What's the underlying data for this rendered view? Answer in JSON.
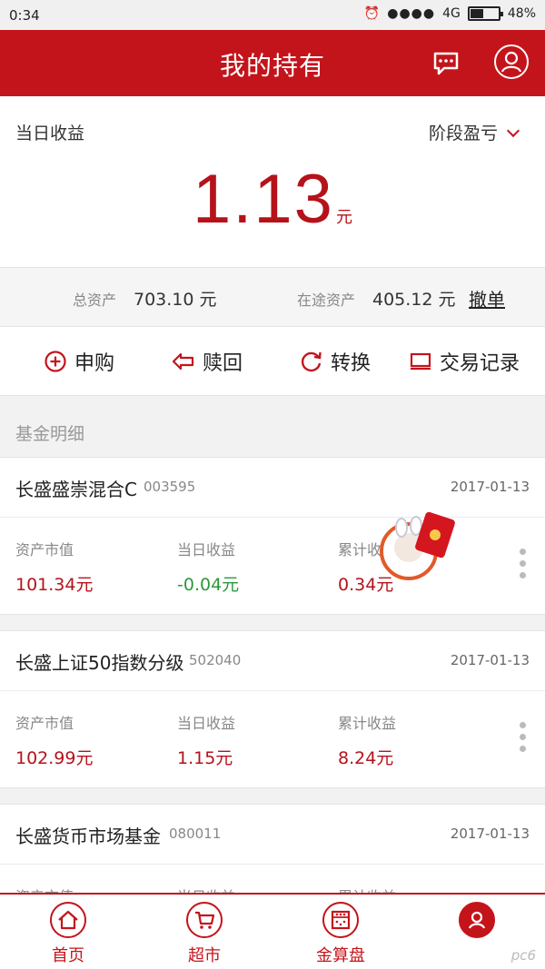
{
  "status_bar": {
    "time": "0:34",
    "network": "4G",
    "battery": "48%",
    "battery_level": 0.48
  },
  "header": {
    "title": "我的持有",
    "message_icon": "chat-icon",
    "user_icon": "user-icon"
  },
  "earnings": {
    "label": "当日收益",
    "period_label": "阶段盈亏",
    "value": "1.13",
    "unit": "元"
  },
  "assets": {
    "total_label": "总资产",
    "total_value": "703.10 元",
    "transit_label": "在途资产",
    "transit_value": "405.12 元",
    "cancel_label": "撤单"
  },
  "actions": [
    {
      "label": "申购",
      "icon": "plus-circle-icon"
    },
    {
      "label": "赎回",
      "icon": "arrow-left-icon"
    },
    {
      "label": "转换",
      "icon": "refresh-icon"
    },
    {
      "label": "交易记录",
      "icon": "monitor-icon"
    }
  ],
  "section_label": "基金明细",
  "funds": [
    {
      "name": "长盛盛崇混合C",
      "code": "003595",
      "date": "2017-01-13",
      "metrics": [
        {
          "label": "资产市值",
          "value": "101.34元"
        },
        {
          "label": "当日收益",
          "value": "-0.04元"
        },
        {
          "label": "累计收益",
          "value": "0.34元"
        }
      ]
    },
    {
      "name": "长盛上证50指数分级",
      "code": "502040",
      "date": "2017-01-13",
      "metrics": [
        {
          "label": "资产市值",
          "value": "102.99元"
        },
        {
          "label": "当日收益",
          "value": "1.15元"
        },
        {
          "label": "累计收益",
          "value": "8.24元"
        }
      ]
    },
    {
      "name": "长盛货币市场基金",
      "code": "080011",
      "date": "2017-01-13",
      "metrics": [
        {
          "label": "资产市值",
          "value": ""
        },
        {
          "label": "当日收益",
          "value": ""
        },
        {
          "label": "累计收益",
          "value": ""
        }
      ]
    }
  ],
  "bottom_nav": [
    {
      "label": "首页",
      "icon": "home-icon"
    },
    {
      "label": "超市",
      "icon": "cart-icon"
    },
    {
      "label": "金算盘",
      "icon": "abacus-icon"
    },
    {
      "label": "",
      "icon": "user-icon"
    }
  ],
  "watermark": "pc6",
  "colors": {
    "brand_red": "#c4141b",
    "positive_red": "#b5121b",
    "negative_green": "#2a9a3a"
  }
}
